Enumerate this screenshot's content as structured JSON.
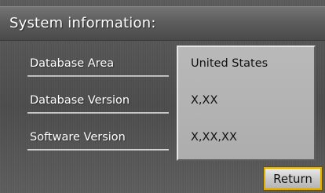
{
  "title": "System information:",
  "rows": [
    {
      "label": "Database Area",
      "value": "United States"
    },
    {
      "label": "Database Version",
      "value": "X,XX"
    },
    {
      "label": "Software Version",
      "value": "X,XX,XX"
    }
  ],
  "return_label": "Return",
  "colors": {
    "background": "#4c4c4c",
    "panel": "#b3b3b3",
    "button_border": "#e0b000"
  }
}
